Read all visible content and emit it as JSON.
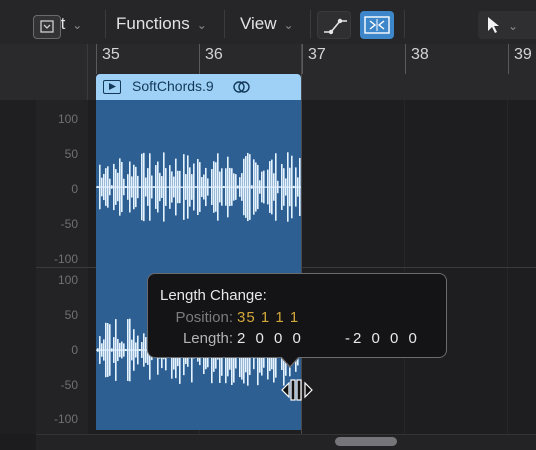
{
  "toolbar": {
    "menus": [
      {
        "label": "Edit"
      },
      {
        "label": "Functions"
      },
      {
        "label": "View"
      }
    ],
    "tools": [
      "automation-curve-tool",
      "flex-tool"
    ],
    "pointer_tool": "pointer-icon"
  },
  "ruler": {
    "bars": [
      "35",
      "36",
      "37",
      "38",
      "39"
    ]
  },
  "region": {
    "name": "SoftChords.9",
    "color": "#9fd0f5",
    "body_color": "#2e5f93"
  },
  "scale": {
    "upper": [
      "100",
      "50",
      "0",
      "-50",
      "-100"
    ],
    "lower": [
      "100",
      "50",
      "0",
      "-50",
      "-100"
    ]
  },
  "help_tag": {
    "title": "Length Change:",
    "position_label": "Position:",
    "position_value": "35 1 1 1",
    "length_label": "Length:",
    "length_value": "2 0 0 0",
    "length_delta": "-2 0 0 0"
  },
  "colors": {
    "accent": "#3d86c9",
    "position_value": "#d3a73a"
  }
}
